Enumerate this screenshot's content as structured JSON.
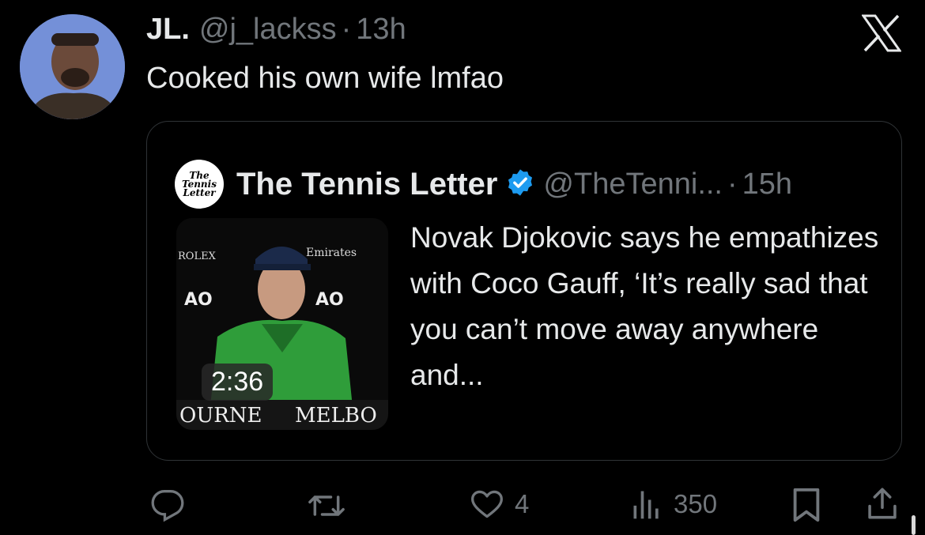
{
  "tweet": {
    "display_name": "JL.",
    "handle": "@j_lackss",
    "separator": "·",
    "time": "13h",
    "text": "Cooked his own wife lmfao"
  },
  "quoted": {
    "logo_text": [
      "The",
      "Tennis",
      "Letter"
    ],
    "display_name": "The Tennis Letter",
    "verified": true,
    "handle": "@TheTenni...",
    "separator": "·",
    "time": "15h",
    "video_duration": "2:36",
    "text": "Novak Djokovic says he empathizes with Coco Gauff, ‘It’s really sad that you can’t move away anywhere and...",
    "thumbnail_board_text": [
      "ROLEX",
      "Emirates",
      "AO",
      "AO",
      "OURNE",
      "MELBO"
    ]
  },
  "actions": {
    "reply_count": "",
    "repost_count": "",
    "like_count": "4",
    "views_count": "350"
  },
  "colors": {
    "background": "#000000",
    "text": "#e7e9ea",
    "muted": "#71767b",
    "verified": "#1d9bf0",
    "border": "#2f3336"
  }
}
